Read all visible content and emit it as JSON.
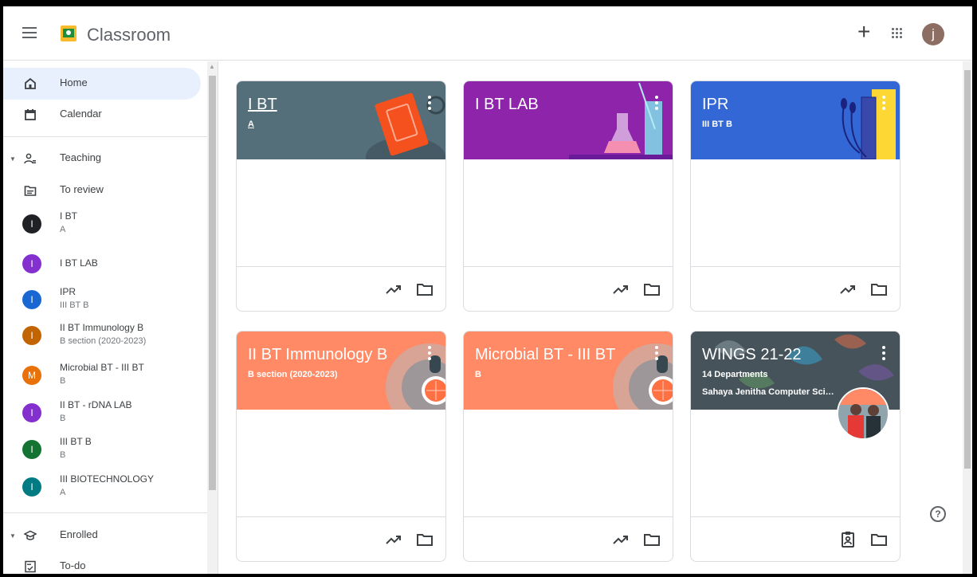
{
  "app": {
    "title": "Classroom",
    "avatar_letter": "j"
  },
  "colors": {
    "accent": "#1a73e8",
    "active_nav": "#e8f0fe"
  },
  "sidebar": {
    "home": "Home",
    "calendar": "Calendar",
    "teaching": "Teaching",
    "to_review": "To review",
    "classes": [
      {
        "letter": "I",
        "name": "I BT",
        "section": "A",
        "color": "#202124"
      },
      {
        "letter": "I",
        "name": "I BT LAB",
        "section": "",
        "color": "#8430ce"
      },
      {
        "letter": "I",
        "name": "IPR",
        "section": "III BT B",
        "color": "#1967d2"
      },
      {
        "letter": "I",
        "name": "II BT Immunology B",
        "section": "B section (2020-2023)",
        "color": "#c26401"
      },
      {
        "letter": "M",
        "name": "Microbial BT - III BT",
        "section": "B",
        "color": "#e8710a"
      },
      {
        "letter": "I",
        "name": "II BT - rDNA LAB",
        "section": "B",
        "color": "#8430ce"
      },
      {
        "letter": "I",
        "name": "III BT B",
        "section": "B",
        "color": "#137333"
      },
      {
        "letter": "I",
        "name": "III BIOTECHNOLOGY",
        "section": "A",
        "color": "#007b83"
      }
    ],
    "enrolled": "Enrolled",
    "todo": "To-do"
  },
  "cards": [
    {
      "title": "I BT",
      "subtitle": "A",
      "color": "#546e7a",
      "icon_left": "insights-icon"
    },
    {
      "title": "I BT LAB",
      "subtitle": "",
      "color": "#8e24aa",
      "icon_left": "insights-icon"
    },
    {
      "title": "IPR",
      "subtitle": "III BT B",
      "color": "#3367d6",
      "icon_left": "insights-icon"
    },
    {
      "title": "II BT Immunology B",
      "subtitle": "B section (2020-2023)",
      "color": "#ff8a65",
      "icon_left": "insights-icon"
    },
    {
      "title": "Microbial BT - III BT",
      "subtitle": "B",
      "color": "#ff8a65",
      "icon_left": "insights-icon"
    },
    {
      "title": "WINGS 21-22",
      "subtitle": "14 Departments",
      "owner": "Sahaya Jenitha Computer Scien...",
      "color": "#6d7b86",
      "icon_left": "assignment-ind-icon"
    }
  ],
  "help": "?"
}
